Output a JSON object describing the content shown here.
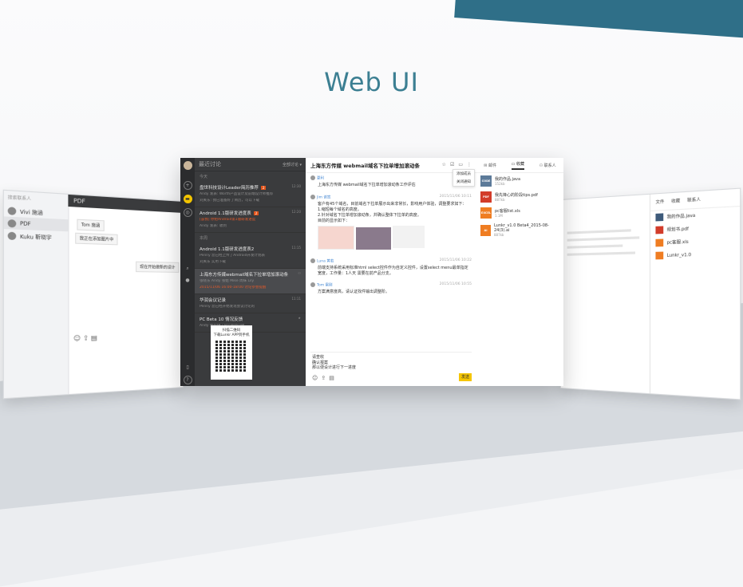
{
  "headline": "Web UI",
  "colors": {
    "accent": "#2f6f88",
    "send": "#f5c500",
    "badge": "#e2541b",
    "dark_list": "#3a3b3d"
  },
  "left_ghost": {
    "search_placeholder": "搜索联系人",
    "header": "PDF",
    "contacts": [
      "Vivi 施涵",
      "PDF",
      "Kuku 靳晓宇"
    ],
    "messages": [
      "Tom 施涵",
      "我正在添加图片中",
      "现在开始做新的设计"
    ]
  },
  "right_ghost": {
    "tabs": [
      "文件",
      "收藏",
      "联系人"
    ],
    "files": [
      "我的作品.java",
      "规划书.pdf",
      "pc客服.xls",
      "Lunkr_v1.0"
    ]
  },
  "main": {
    "list_header": {
      "title": "最近讨论",
      "filter": "全部讨论 ▾"
    },
    "groups": [
      {
        "label": "今天",
        "items": [
          {
            "title": "盘世科技设计Leader简历推荐",
            "badge": "2",
            "time": "12:30",
            "sub": "Andy 发表: Worth产品设计及前端设计师推荐",
            "sub2": "刘关东: 我已准备好了简历，可以下载"
          },
          {
            "title": "Android 1.1版研发进度表",
            "badge": "2",
            "time": "12:20",
            "sub": "[@我] 你把Android第1版研发进度",
            "sub2": "Andy 发表: 收到"
          }
        ]
      },
      {
        "label": "本周",
        "items": [
          {
            "title": "Android 1.1版研发进度表2",
            "time": "11:15",
            "sub": "Penny 您已经上传了Android开发计划表",
            "sub2": "刘关东 实用下载"
          },
          {
            "title": "上海东方传媒webmail域名下拉单增加滚动条",
            "time": "",
            "sub": "张晓东 Andy 张姐 Mike 周妹 Lily",
            "sub2": "2015/11/06 16:00-18:00 讨论参会提醒",
            "selected": true
          },
          {
            "title": "华润会议记录",
            "time": "11:11",
            "sub": "Penny 您已经开始发现会议讨论的",
            "sub2": ""
          },
          {
            "title": "PC Beta 10 情况反馈",
            "time": "11:00",
            "sub": "Andy 共提供了9个测试问题",
            "sub2": ""
          }
        ]
      }
    ],
    "qr": {
      "line1": "扫描二维码",
      "line2": "下载Lunkr APP到手机"
    },
    "chat": {
      "title": "上海东方传媒 webmail域名下拉单增加滚动条",
      "dropdown": [
        "添加成员",
        "关闭通知"
      ],
      "messages": [
        {
          "who": "夏利",
          "time": "",
          "body": [
            "上海东方传媒 webmail域名下拉单增加滚动条工作评估"
          ]
        },
        {
          "who": "Jim 谢宽",
          "time": "2015/11/06 10:11",
          "body": [
            "客户有45个域名，目前域名下拉单展示出来非常长，影响用户体验，调整要求如下：",
            "1.缩短每个域名的高度。",
            "2.针对域名下拉单增加滚动条，并确认整体下拉单的高度。",
            "目前的显示如下："
          ]
        },
        {
          "who": "Luna 黄若",
          "time": "2015/11/06 10:22",
          "body": [
            "前端支持系统采用标准html select控件作为自定义控件，设置select menu最单指定",
            "宽度，工作量：1人天 需要在前产品分支。"
          ]
        },
        {
          "who": "Tom 雷刚",
          "time": "2015/11/06 10:55",
          "body": [
            "方案满意度高，请认证找件输出调整阶。"
          ]
        }
      ],
      "compose": [
        "请查收",
        "确认报案",
        "那以便设计进行下一进度"
      ],
      "send": "发送"
    },
    "pane": {
      "tabs": [
        "邮件",
        "收藏",
        "联系人"
      ],
      "files": [
        {
          "icon": "CODE",
          "name": "我的作品.java",
          "size": "152kb",
          "color": "#5c7a99"
        },
        {
          "icon": "PDF",
          "name": "我先锋心的阶段tips.pdf",
          "size": "887kb",
          "color": "#d23c2a"
        },
        {
          "icon": "EXCEL",
          "name": "pc客服list.xls",
          "size": "1.1M",
          "color": "#ef7d22"
        },
        {
          "icon": "AI",
          "name": "Lunkr_v1.0 Beta4_2015-08-24(3).ai",
          "size": "887kb",
          "color": "#ef7d22"
        }
      ]
    }
  }
}
